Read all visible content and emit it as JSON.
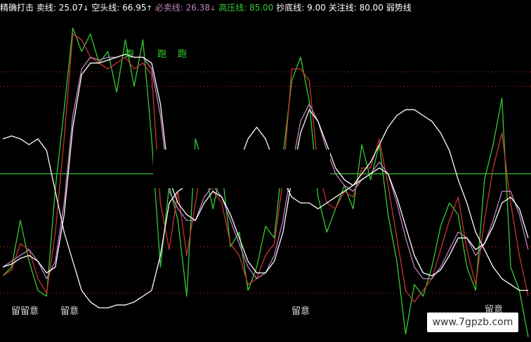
{
  "legend": [
    {
      "label": "精确打击",
      "value": "",
      "color": "#ffffff",
      "arrow": ""
    },
    {
      "label": "卖线",
      "value": "25.07",
      "color": "#ffffff",
      "arrow": "↓"
    },
    {
      "label": "空头线",
      "value": "66.95",
      "color": "#ffffff",
      "arrow": "↑"
    },
    {
      "label": "必卖线",
      "value": "26.38",
      "color": "#c080c0",
      "arrow": "↓"
    },
    {
      "label": "高压线",
      "value": "85.00",
      "color": "#33cc33",
      "arrow": ""
    },
    {
      "label": "抄底线",
      "value": "9.00",
      "color": "#ffffff",
      "arrow": ""
    },
    {
      "label": "关注线",
      "value": "80.00",
      "color": "#ffffff",
      "arrow": ""
    },
    {
      "label": "弱势线",
      "value": "",
      "color": "#ffffff",
      "arrow": ""
    }
  ],
  "annotations": [
    {
      "id": "run-1",
      "text": "跑",
      "color": "#33cc33"
    },
    {
      "id": "run-2",
      "text": "跑",
      "color": "#33cc33"
    },
    {
      "id": "run-3",
      "text": "跑",
      "color": "#33cc33"
    },
    {
      "id": "watch-1",
      "text": "留留意",
      "color": "#dddddd"
    },
    {
      "id": "watch-2",
      "text": "留意",
      "color": "#dddddd"
    },
    {
      "id": "watch-3",
      "text": "留意",
      "color": "#dddddd"
    },
    {
      "id": "watch-4",
      "text": "留意",
      "color": "#dddddd"
    }
  ],
  "watermark": "www.7gpzb.com",
  "chart_data": {
    "type": "line",
    "ylim": [
      0,
      100
    ],
    "reference_lines": [
      {
        "name": "高压线",
        "y": 85,
        "color": "#cc3333",
        "style": "dotted"
      },
      {
        "name": "关注线",
        "y": 80,
        "color": "#cc3333",
        "style": "dotted"
      },
      {
        "name": "",
        "y": 50,
        "color": "#33aa33",
        "style": "solid"
      },
      {
        "name": "",
        "y": 25,
        "color": "#cc3333",
        "style": "dotted"
      },
      {
        "name": "抄底线",
        "y": 9,
        "color": "#cc3333",
        "style": "dotted"
      }
    ],
    "x": [
      0,
      1,
      2,
      3,
      4,
      5,
      6,
      7,
      8,
      9,
      10,
      11,
      12,
      13,
      14,
      15,
      16,
      17,
      18,
      19,
      20,
      21,
      22,
      23,
      24,
      25,
      26,
      27,
      28,
      29,
      30,
      31,
      32,
      33,
      34,
      35,
      36,
      37,
      38,
      39,
      40,
      41,
      42,
      43,
      44,
      45,
      46,
      47,
      48,
      49,
      50,
      51,
      52,
      53,
      54,
      55,
      56,
      57,
      58,
      59,
      60
    ],
    "series": [
      {
        "color": "#33cc33",
        "values": [
          15,
          18,
          34,
          20,
          10,
          8,
          45,
          72,
          100,
          92,
          98,
          88,
          92,
          78,
          96,
          80,
          96,
          62,
          18,
          46,
          34,
          8,
          62,
          52,
          38,
          52,
          25,
          30,
          10,
          18,
          32,
          28,
          56,
          82,
          90,
          75,
          42,
          30,
          38,
          46,
          38,
          60,
          48,
          60,
          36,
          20,
          -5,
          12,
          8,
          18,
          32,
          40,
          36,
          18,
          10,
          48,
          60,
          76,
          18,
          10,
          -6
        ]
      },
      {
        "color": "#cc3333",
        "values": [
          15,
          17,
          26,
          24,
          14,
          9,
          30,
          62,
          98,
          96,
          90,
          88,
          86,
          88,
          90,
          86,
          88,
          84,
          40,
          24,
          44,
          22,
          40,
          58,
          44,
          40,
          26,
          22,
          12,
          14,
          22,
          26,
          48,
          86,
          86,
          82,
          52,
          40,
          38,
          44,
          42,
          52,
          52,
          62,
          46,
          28,
          10,
          6,
          10,
          14,
          24,
          34,
          42,
          24,
          12,
          34,
          52,
          64,
          40,
          22,
          8
        ]
      },
      {
        "color": "#c080c0",
        "values": [
          18,
          20,
          22,
          24,
          20,
          14,
          20,
          40,
          70,
          86,
          90,
          89,
          90,
          90,
          91,
          90,
          90,
          86,
          70,
          44,
          38,
          34,
          34,
          42,
          46,
          42,
          34,
          26,
          18,
          14,
          16,
          22,
          34,
          52,
          68,
          74,
          68,
          58,
          50,
          46,
          44,
          48,
          50,
          54,
          50,
          40,
          28,
          18,
          14,
          14,
          18,
          24,
          30,
          28,
          22,
          26,
          34,
          44,
          44,
          36,
          24
        ]
      },
      {
        "color": "#ffffff",
        "values": [
          18,
          19,
          21,
          22,
          20,
          16,
          18,
          36,
          66,
          84,
          88,
          88,
          89,
          90,
          91,
          90,
          90,
          88,
          74,
          48,
          40,
          36,
          34,
          40,
          44,
          42,
          36,
          28,
          20,
          16,
          16,
          20,
          30,
          48,
          64,
          72,
          68,
          60,
          52,
          48,
          46,
          48,
          50,
          52,
          50,
          42,
          32,
          22,
          16,
          15,
          17,
          22,
          28,
          28,
          24,
          26,
          32,
          40,
          42,
          38,
          28
        ]
      },
      {
        "color": "#ffffff",
        "values": [
          62,
          63,
          62,
          60,
          62,
          58,
          44,
          30,
          20,
          10,
          6,
          4,
          4,
          5,
          5,
          6,
          8,
          10,
          22,
          40,
          44,
          46,
          48,
          52,
          54,
          55,
          55,
          54,
          62,
          66,
          62,
          54,
          48,
          42,
          40,
          40,
          38,
          40,
          42,
          44,
          46,
          50,
          54,
          60,
          66,
          70,
          72,
          72,
          70,
          68,
          64,
          58,
          48,
          40,
          30,
          24,
          18,
          14,
          12,
          10,
          10
        ]
      }
    ]
  }
}
